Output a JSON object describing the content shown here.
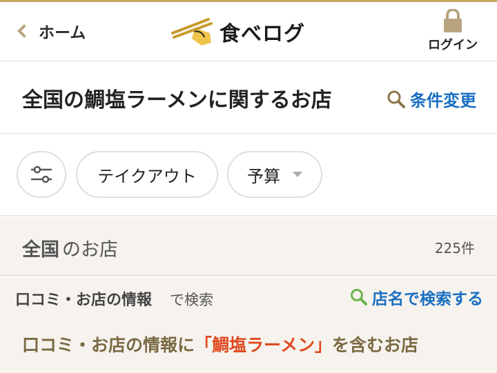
{
  "header": {
    "home_label": "ホーム",
    "logo_text": "食べログ",
    "login_label": "ログイン",
    "accent_color": "#c8a964"
  },
  "title_bar": {
    "title": "全国の鯛塩ラーメンに関するお店",
    "change_conditions_label": "条件変更",
    "link_color": "#1a6fc2"
  },
  "filters": {
    "filter_icon": "sliders-icon",
    "chips": [
      "テイクアウト",
      "予算"
    ]
  },
  "area": {
    "region": "全国",
    "suffix": "のお店",
    "count": "225件"
  },
  "search": {
    "label_strong": "口コミ・お店の情報",
    "label_rest": "で検索",
    "shop_name_search_label": "店名で検索する",
    "shop_search_icon_color": "#6bb34a"
  },
  "keyword": {
    "prefix": "口コミ・お店の情報に",
    "keyword_quoted": "「鯛塩ラーメン」",
    "suffix": "を含むお店",
    "keyword_color": "#e04a1f"
  }
}
